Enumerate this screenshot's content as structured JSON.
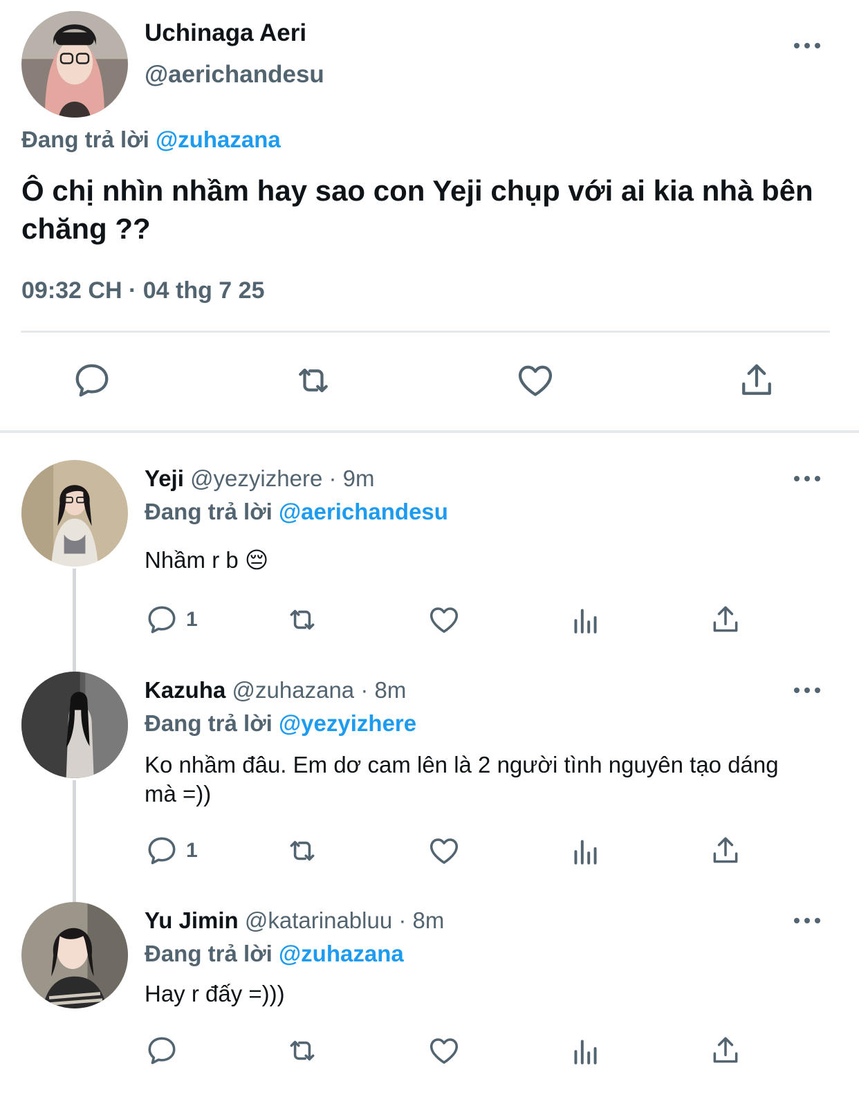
{
  "main_tweet": {
    "author_name": "Uchinaga Aeri",
    "author_handle": "@aerichandesu",
    "replying_label": "Đang trả lời",
    "replying_to": "@zuhazana",
    "text": "Ô chị nhìn nhầm hay sao con Yeji chụp với ai kia nhà bên chăng ??",
    "timestamp": "09:32 CH · 04 thg 7 25",
    "actions": [
      "reply-icon",
      "retweet-icon",
      "like-icon",
      "share-icon"
    ]
  },
  "replies": [
    {
      "name": "Yeji",
      "meta": "@yezyizhere · 9m",
      "replying_label": "Đang trả lời",
      "replying_to": "@aerichandesu",
      "text": "Nhầm r b 😔",
      "reply_count": "1"
    },
    {
      "name": "Kazuha",
      "meta": "@zuhazana · 8m",
      "replying_label": "Đang trả lời",
      "replying_to": "@yezyizhere",
      "text": "Ko nhầm đâu. Em dơ cam lên là 2 người tình nguyên tạo dáng mà =))",
      "reply_count": "1"
    },
    {
      "name": "Yu Jimin",
      "meta": "@katarinabluu · 8m",
      "replying_label": "Đang trả lời",
      "replying_to": "@zuhazana",
      "text": "Hay r đấy =)))",
      "reply_count": ""
    }
  ],
  "colors": {
    "text_primary": "#0f1419",
    "text_secondary": "#536471",
    "accent": "#1d9bf0",
    "divider": "#e6e9eb"
  }
}
